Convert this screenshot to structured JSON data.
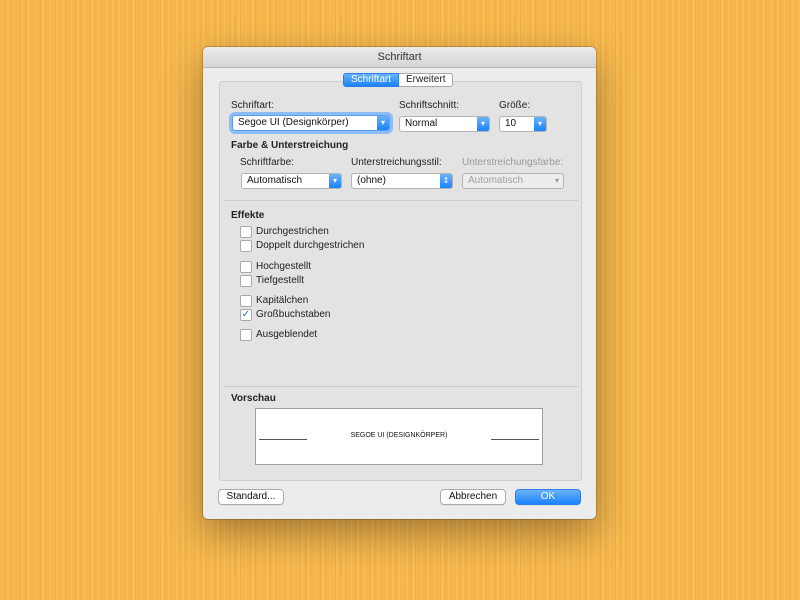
{
  "window": {
    "title": "Schriftart"
  },
  "tabs": [
    {
      "label": "Schriftart",
      "selected": true
    },
    {
      "label": "Erweitert",
      "selected": false
    }
  ],
  "font": {
    "label": "Schriftart:",
    "value": "Segoe UI (Designkörper)",
    "style_label": "Schriftschnitt:",
    "style_value": "Normal",
    "size_label": "Größe:",
    "size_value": "10"
  },
  "color_underline": {
    "heading": "Farbe & Unterstreichung",
    "font_color_label": "Schriftfarbe:",
    "font_color_value": "Automatisch",
    "underline_style_label": "Unterstreichungsstil:",
    "underline_style_value": "(ohne)",
    "underline_color_label": "Unterstreichungsfarbe:",
    "underline_color_value": "Automatisch"
  },
  "effects": {
    "heading": "Effekte",
    "items": [
      {
        "label": "Durchgestrichen",
        "checked": false
      },
      {
        "label": "Doppelt durchgestrichen",
        "checked": false
      },
      {
        "label": "Hochgestellt",
        "checked": false
      },
      {
        "label": "Tiefgestellt",
        "checked": false
      },
      {
        "label": "Kapitälchen",
        "checked": false
      },
      {
        "label": "Großbuchstaben",
        "checked": true
      },
      {
        "label": "Ausgeblendet",
        "checked": false
      }
    ]
  },
  "preview": {
    "heading": "Vorschau",
    "text": "SEGOE UI (DESIGNKÖRPER)"
  },
  "buttons": {
    "default": "Standard...",
    "cancel": "Abbrechen",
    "ok": "OK"
  },
  "colors": {
    "accent": "#1a82fb",
    "background": "#f7b74a",
    "dialog": "#ececec"
  }
}
